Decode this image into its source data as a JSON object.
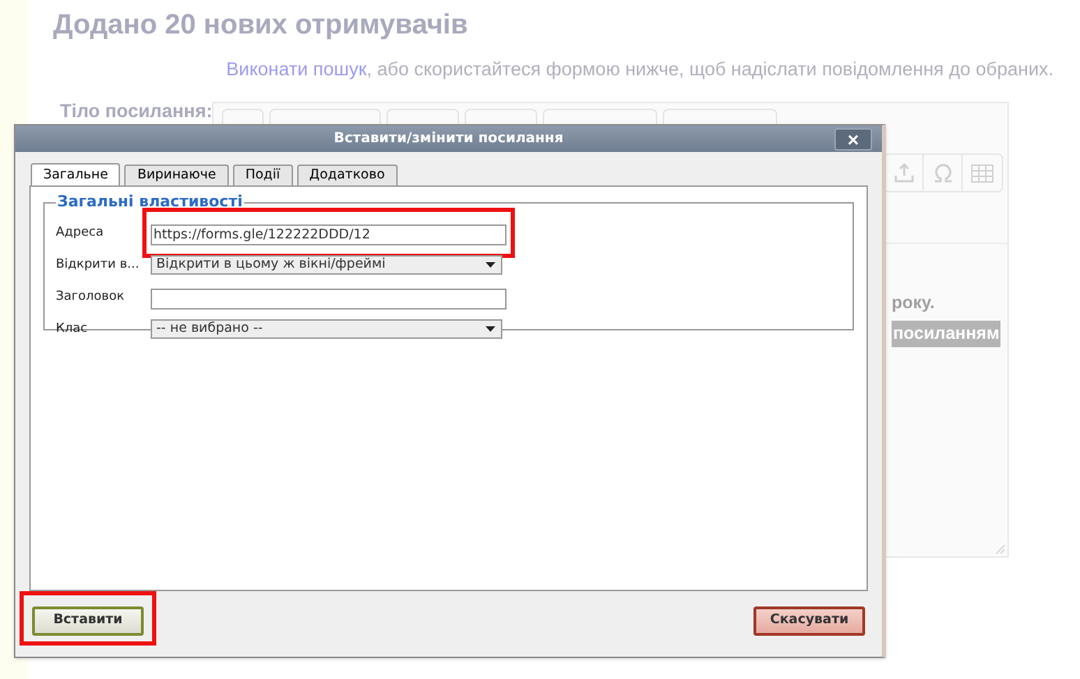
{
  "page": {
    "heading": "Додано 20 нових отримувачів",
    "intro_link": "Виконати пошук",
    "intro_text": ", або скористайтеся формою нижче, щоб надіслати повідомлення до обраних.",
    "body_label": "Тіло посилання:",
    "editor_fragments": [
      {
        "text": "року.",
        "highlighted": false
      },
      {
        "text": "посиланням",
        "highlighted": true
      }
    ]
  },
  "dialog": {
    "title": "Вставити/змінити посилання",
    "close": "×",
    "tabs": [
      {
        "label": "Загальне",
        "selected": true
      },
      {
        "label": "Виринаюче",
        "selected": false
      },
      {
        "label": "Події",
        "selected": false
      },
      {
        "label": "Додатково",
        "selected": false
      }
    ],
    "legend": "Загальні властивості",
    "fields": [
      {
        "kind": "text",
        "label": "Адреса",
        "value": "https://forms.gle/122222DDD/12",
        "highlighted": true
      },
      {
        "kind": "select",
        "label": "Відкрити в...",
        "value": "Відкрити в цьому ж вікні/фреймі",
        "highlighted": false
      },
      {
        "kind": "text",
        "label": "Заголовок",
        "highlighted": false
      },
      {
        "kind": "select",
        "label": "Клас",
        "value": "-- не вибрано --",
        "highlighted": false
      }
    ],
    "buttons": [
      {
        "kind": "insert",
        "label": "Вставити",
        "highlighted": true
      },
      {
        "kind": "cancel",
        "label": "Скасувати",
        "highlighted": false
      }
    ]
  }
}
